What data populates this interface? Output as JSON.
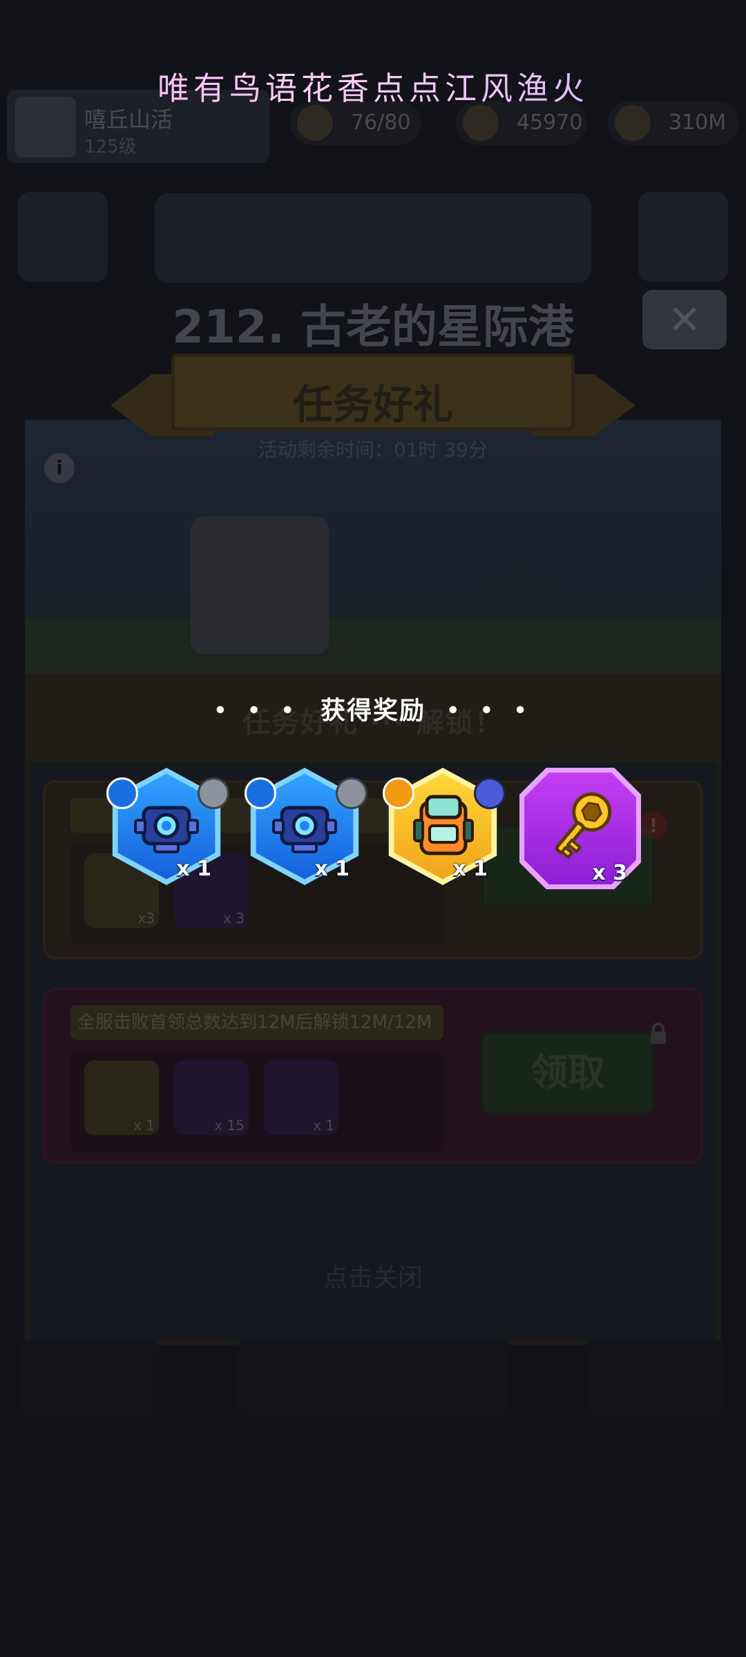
{
  "watermark": "唯有鸟语花香点点江风渔火",
  "background": {
    "player": {
      "name": "嘻丘山活",
      "level": "125级"
    },
    "resources": [
      "76/80",
      "45970",
      "310M"
    ],
    "level_title": "212. 古老的星际港",
    "close_label": "✕"
  },
  "event": {
    "title": "任务好礼",
    "timer": "活动剩余时间：01时 39分",
    "unlock_notice": "任务好礼 ··· 解锁！",
    "tasks": [
      {
        "label": "",
        "items": [
          {
            "icon": "treasure-chest-icon",
            "count": "x3"
          },
          {
            "icon": "golden-key-icon",
            "count": "x 3"
          }
        ],
        "button": ""
      },
      {
        "label": "全服击败首领总数达到12M后解锁12M/12M",
        "items": [
          {
            "icon": "treasure-chest-icon",
            "count": "x 1"
          },
          {
            "icon": "golden-key-icon",
            "count": "x 15"
          },
          {
            "icon": "scroll-card-icon",
            "count": "x 1"
          }
        ],
        "button": "领取"
      }
    ],
    "tap_to_close": "点击关闭"
  },
  "popup": {
    "title": "获得奖励",
    "dots": "• • •",
    "rewards": [
      {
        "icon": "blue-robot-gear-icon",
        "rarity": "blue",
        "qty": "x 1"
      },
      {
        "icon": "blue-robot-gear-icon",
        "rarity": "blue",
        "qty": "x 1"
      },
      {
        "icon": "backpack-gear-icon",
        "rarity": "gold",
        "qty": "x 1"
      },
      {
        "icon": "golden-key-icon",
        "rarity": "purple",
        "qty": "x 3"
      }
    ]
  },
  "colors": {
    "blue": "#1f7bef",
    "gold": "#f5b526",
    "purple": "#a62ee6",
    "overlay": "#0b0c10"
  }
}
